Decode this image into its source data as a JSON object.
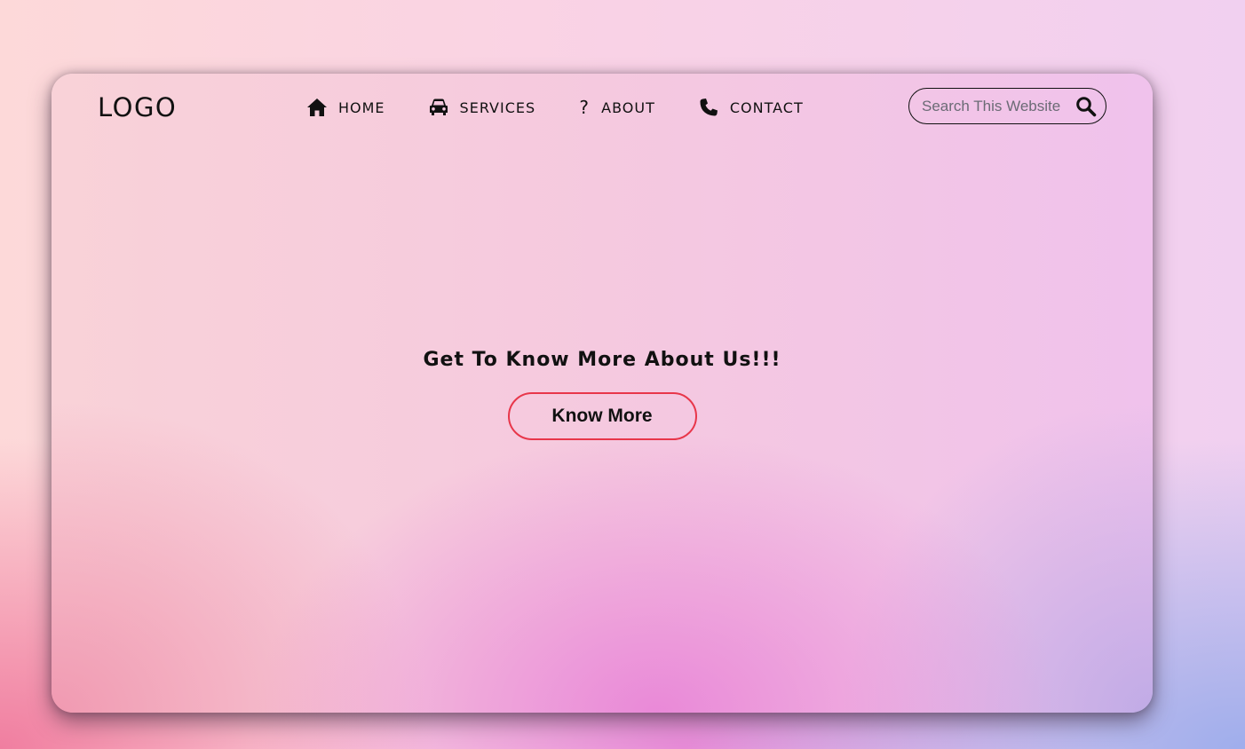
{
  "header": {
    "logo": "LOGO",
    "nav": [
      {
        "label": "HOME",
        "icon": "home-icon"
      },
      {
        "label": "SERVICES",
        "icon": "car-icon"
      },
      {
        "label": "ABOUT",
        "icon": "question-icon"
      },
      {
        "label": "CONTACT",
        "icon": "phone-icon"
      }
    ],
    "search": {
      "placeholder": "Search This Website",
      "value": "",
      "icon": "search-icon"
    }
  },
  "hero": {
    "title": "Get To Know More About Us!!!",
    "button_label": "Know More"
  },
  "colors": {
    "text": "#111111",
    "button_border": "#e8364a"
  }
}
